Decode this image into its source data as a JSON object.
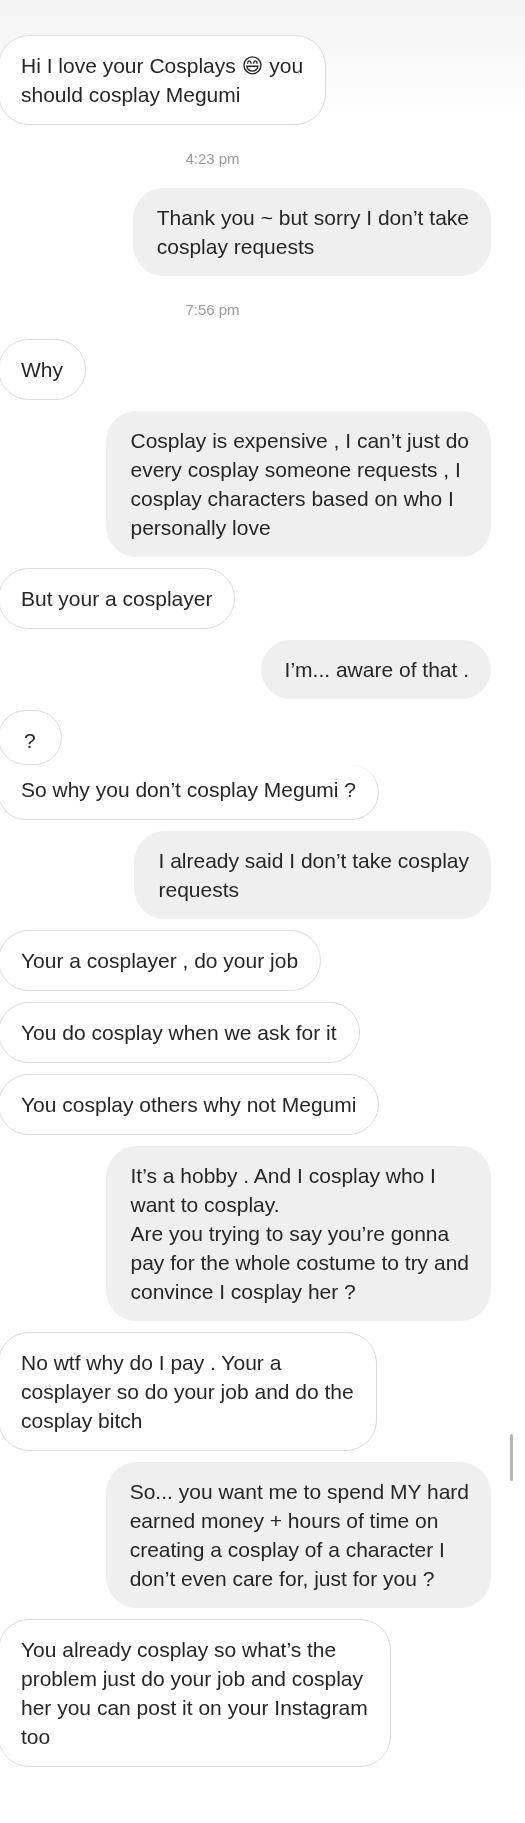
{
  "messages": [
    {
      "kind": "received",
      "lines": [
        "Hi I love your Cosplays 😄  you",
        "should cosplay Megumi"
      ]
    },
    {
      "kind": "time",
      "text": "4:23 pm"
    },
    {
      "kind": "sent",
      "lines": [
        "Thank you ~ but sorry I don’t take",
        "cosplay requests"
      ]
    },
    {
      "kind": "time",
      "text": "7:56 pm"
    },
    {
      "kind": "received",
      "lines": [
        "Why"
      ]
    },
    {
      "kind": "sent",
      "lines": [
        "Cosplay is expensive , I can’t just do",
        "every cosplay someone requests , I",
        "cosplay characters based on who I",
        "personally love"
      ]
    },
    {
      "kind": "received",
      "lines": [
        "But your a cosplayer"
      ]
    },
    {
      "kind": "sent",
      "lines": [
        "I’m... aware of that ."
      ]
    },
    {
      "kind": "received_cut_bottom",
      "lines": [
        "?"
      ]
    },
    {
      "kind": "received_cut_top",
      "lines": [
        "So why you don’t cosplay Megumi ?"
      ]
    },
    {
      "kind": "sent",
      "lines": [
        "I already said I don’t take cosplay",
        "requests"
      ]
    },
    {
      "kind": "received",
      "lines": [
        "Your a cosplayer , do your job"
      ]
    },
    {
      "kind": "received",
      "lines": [
        "You do cosplay when we ask for it"
      ]
    },
    {
      "kind": "received",
      "lines": [
        "You cosplay others why not Megumi"
      ]
    },
    {
      "kind": "sent",
      "lines": [
        "It’s a hobby . And I cosplay who I",
        "want to cosplay.",
        "Are you trying to say you’re gonna",
        "pay for the whole costume to try and",
        "convince I cosplay her ?"
      ]
    },
    {
      "kind": "received",
      "lines": [
        "No wtf why do I pay . Your a",
        "cosplayer so do your job and do the",
        "cosplay bitch"
      ]
    },
    {
      "kind": "sent",
      "lines": [
        "So... you want me to spend MY hard",
        "earned money + hours of time on",
        "creating a cosplay of a character I",
        "don’t even care for,  just for you ?"
      ]
    },
    {
      "kind": "received",
      "lines": [
        "You already cosplay so what’s the",
        "problem just do your job and cosplay",
        "her you can post it on your Instagram",
        "too"
      ]
    }
  ]
}
